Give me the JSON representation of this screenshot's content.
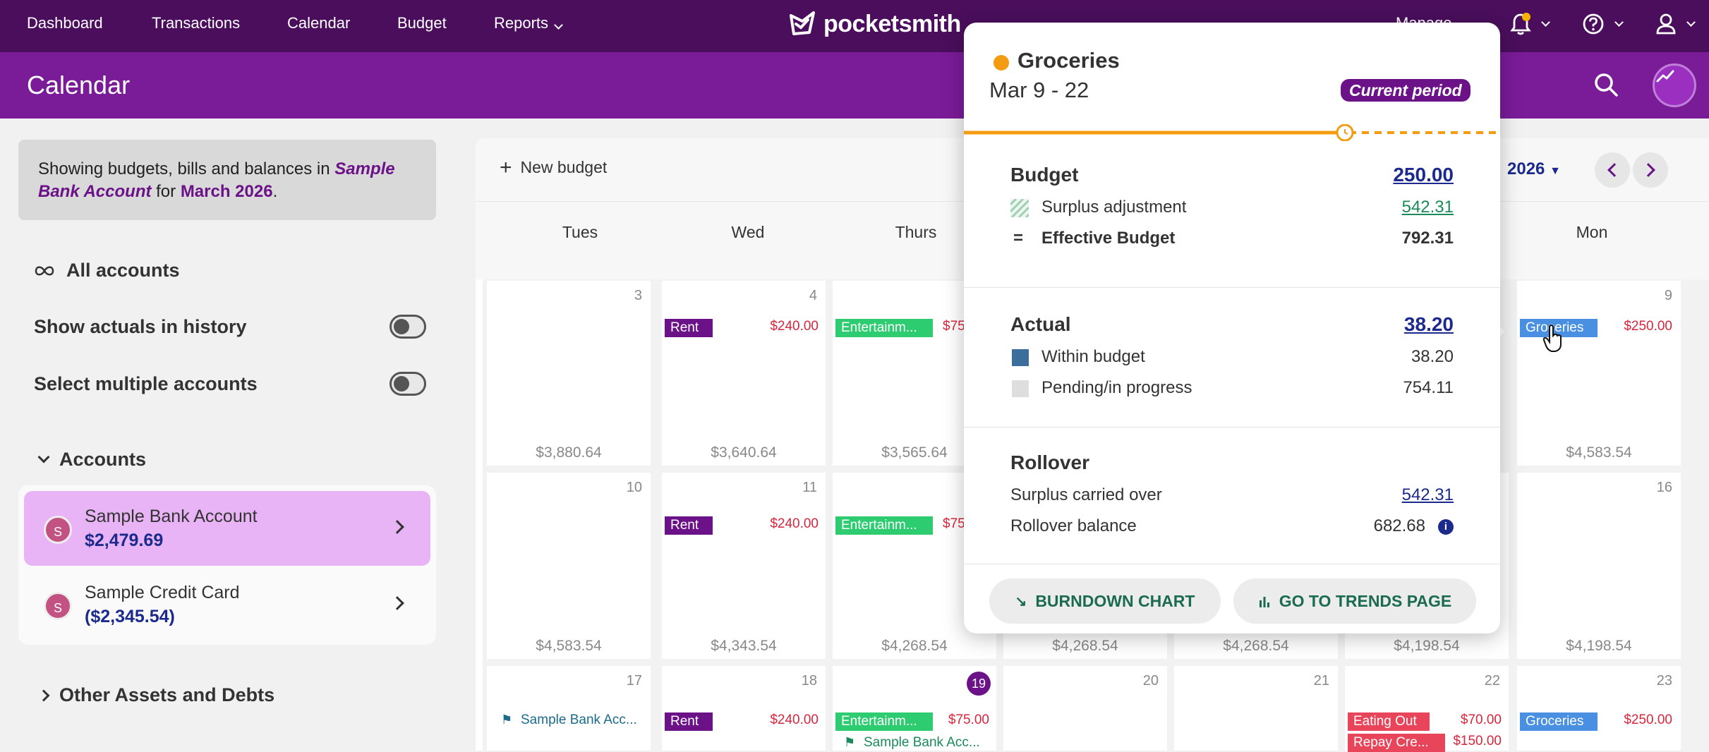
{
  "nav": {
    "items": [
      "Dashboard",
      "Transactions",
      "Calendar",
      "Budget",
      "Reports"
    ],
    "logo": "pocketsmith",
    "manage": "Manage"
  },
  "page": {
    "title": "Calendar"
  },
  "sidebar": {
    "info_prefix": "Showing budgets, bills and balances in ",
    "info_account": "Sample Bank Account",
    "info_mid": " for ",
    "info_month": "March 2026",
    "info_suffix": ".",
    "all_accounts": "All accounts",
    "show_actuals": "Show actuals in history",
    "select_multiple": "Select multiple accounts",
    "accounts_heading": "Accounts",
    "accounts": [
      {
        "initial": "S",
        "name": "Sample Bank Account",
        "balance": "$2,479.69"
      },
      {
        "initial": "S",
        "name": "Sample Credit Card",
        "balance": "($2,345.54)"
      }
    ],
    "other_assets": "Other Assets and Debts"
  },
  "calendar": {
    "new_budget": "New budget",
    "year": "2026",
    "days": [
      "Tues",
      "Wed",
      "Thurs",
      "Mon"
    ],
    "week1": {
      "tue": {
        "day": "3",
        "balance": "$3,880.64"
      },
      "wed": {
        "day": "4",
        "chip": "Rent",
        "amount": "$240.00",
        "balance": "$3,640.64"
      },
      "thu": {
        "chip": "Entertainm...",
        "amount": "$75",
        "balance": "$3,565.64"
      },
      "mon": {
        "day": "9",
        "chip": "Groceries",
        "amount": "$250.00",
        "balance": "$4,583.54"
      }
    },
    "week2": {
      "tue": {
        "day": "10",
        "balance": "$4,583.54"
      },
      "wed": {
        "day": "11",
        "chip": "Rent",
        "amount": "$240.00",
        "balance": "$4,343.54"
      },
      "thu": {
        "chip": "Entertainm...",
        "amount": "$75",
        "balance": "$4,268.54"
      },
      "fri": {
        "balance": "$4,268.54"
      },
      "sat": {
        "balance": "$4,268.54"
      },
      "sun": {
        "balance": "$4,198.54"
      },
      "mon": {
        "day": "16",
        "balance": "$4,198.54"
      }
    },
    "week3": {
      "tue": {
        "day": "17",
        "chip": "Sample Bank Acc..."
      },
      "wed": {
        "day": "18",
        "chip": "Rent",
        "amount": "$240.00"
      },
      "thu": {
        "day": "19",
        "chip": "Entertainm...",
        "amount": "$75.00",
        "chip2": "Sample Bank Acc..."
      },
      "fri": {
        "day": "20"
      },
      "sat": {
        "day": "21"
      },
      "sun": {
        "day": "22",
        "chip": "Eating Out",
        "amount": "$70.00",
        "chip2": "Repay Cre...",
        "amount2": "$150.00"
      },
      "mon": {
        "day": "23",
        "chip": "Groceries",
        "amount": "$250.00"
      }
    }
  },
  "popover": {
    "category": "Groceries",
    "period": "Mar 9 - 22",
    "badge": "Current period",
    "budget_label": "Budget",
    "budget_value": "250.00",
    "surplus_adj_label": "Surplus adjustment",
    "surplus_adj_value": "542.31",
    "effective_label": "Effective Budget",
    "effective_value": "792.31",
    "actual_label": "Actual",
    "actual_value": "38.20",
    "within_label": "Within budget",
    "within_value": "38.20",
    "pending_label": "Pending/in progress",
    "pending_value": "754.11",
    "rollover_label": "Rollover",
    "surplus_carried_label": "Surplus carried over",
    "surplus_carried_value": "542.31",
    "rollover_balance_label": "Rollover balance",
    "rollover_balance_value": "682.68",
    "burndown_btn": "BURNDOWN CHART",
    "trends_btn": "GO TO TRENDS PAGE"
  },
  "colors": {
    "nav_bg": "#4a0e5c",
    "header_bg": "#7a1b98",
    "accent_purple": "#6b1289",
    "groceries_dot": "#f39c12",
    "rent_chip": "#6b1289",
    "entertainment_chip": "#2ecc71",
    "groceries_chip": "#4a90e2",
    "eating_out_chip": "#e8455a"
  }
}
